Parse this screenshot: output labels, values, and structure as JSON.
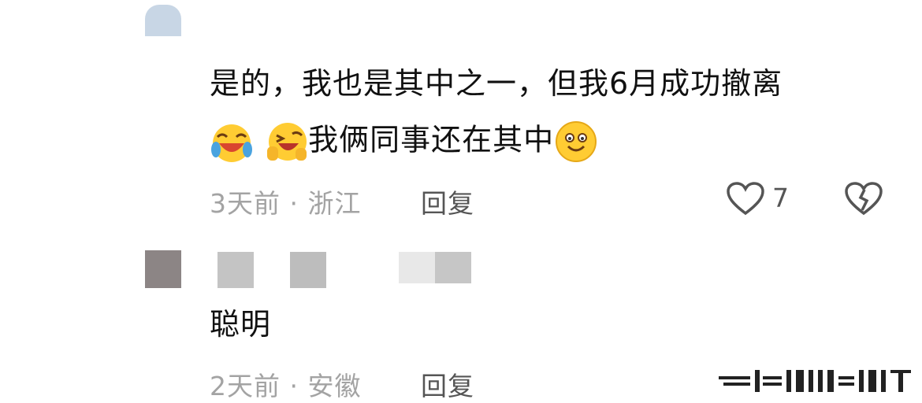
{
  "comments": [
    {
      "text_line1": "是的，我也是其中之一，但我6月成功撤离",
      "text_line2": "我俩同事还在其中",
      "emojis": [
        "laughing-crying-emoji",
        "winking-laughing-emoji",
        "smiling-emoji"
      ],
      "time": "3天前",
      "location": "浙江",
      "reply_label": "回复",
      "like_count": "7",
      "icons": [
        "heart-icon",
        "broken-heart-icon"
      ]
    },
    {
      "text": "聪明",
      "time": "2天前",
      "location": "安徽",
      "reply_label": "回复"
    }
  ],
  "separator": " · ",
  "colors": {
    "text": "#111111",
    "meta": "#a3a3a3",
    "accent_gray": "#555555"
  }
}
